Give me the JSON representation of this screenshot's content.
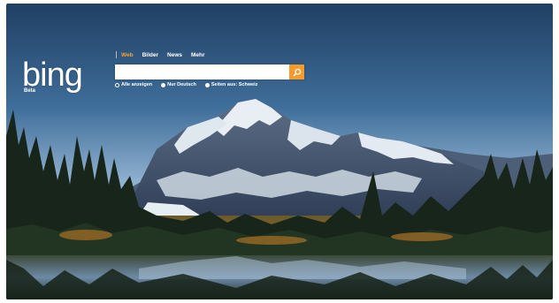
{
  "brand": {
    "logo": "bing",
    "badge": "Beta"
  },
  "nav": {
    "tabs": [
      {
        "label": "Web",
        "active": true
      },
      {
        "label": "Bilder",
        "active": false
      },
      {
        "label": "News",
        "active": false
      },
      {
        "label": "Mehr",
        "active": false
      }
    ]
  },
  "search": {
    "value": "",
    "placeholder": ""
  },
  "scope_options": [
    {
      "label": "Alle anzeigen",
      "selected": true
    },
    {
      "label": "Nur Deutsch",
      "selected": false
    },
    {
      "label": "Seiten aus: Schweiz",
      "selected": false
    }
  ],
  "colors": {
    "accent": "#f39c2b",
    "active_tab": "#f7a13a",
    "sky_top": "#203f63",
    "sky_bottom": "#a9c2d9"
  },
  "icons": {
    "search_button": "magnifier-icon"
  }
}
